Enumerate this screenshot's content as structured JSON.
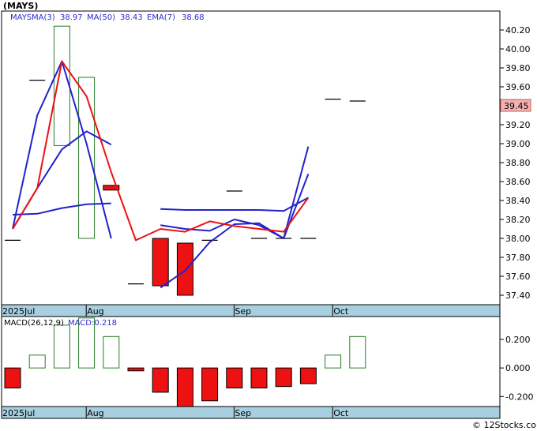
{
  "title": "(MAYS)",
  "watermark": "© 12Stocks.com",
  "last_price_label": "39.45",
  "colors": {
    "up": "#2a7a2a",
    "down": "#ee1111",
    "blue_line": "#2222cc",
    "red_line": "#ee1111",
    "date_band": "#a8cfe0",
    "price_tag_bg": "#f5b0b0",
    "grid": "#cccccc"
  },
  "legend": {
    "ticker": "MAYS",
    "ma3": "MA(3)",
    "ma3_value": "38.97",
    "ma50": "MA(50)",
    "ma50_value": "38.43",
    "ema7": "EMA(7)",
    "ema7_value": "38.68"
  },
  "macd_legend": {
    "label": "MACD(26,12,9)",
    "value_label": "MACD:0.218"
  },
  "chart_data": [
    {
      "type": "candlestick",
      "panel": "price",
      "dates": [
        "2025Jul",
        "Aug",
        "Sep",
        "Oct"
      ],
      "date_positions_bar": [
        0,
        3.5,
        9.5,
        13.5
      ],
      "ylim": [
        37.3,
        40.4
      ],
      "yticks": [
        "37.40",
        "37.60",
        "37.80",
        "38.00",
        "38.20",
        "38.40",
        "38.60",
        "38.80",
        "39.00",
        "39.20",
        "39.40",
        "39.60",
        "39.80",
        "40.00",
        "40.20"
      ],
      "bars": [
        {
          "open": 37.98,
          "close": 37.98
        },
        {
          "open": 39.67,
          "close": 39.67
        },
        {
          "open": 38.98,
          "close": 40.24
        },
        {
          "open": 38.0,
          "close": 39.7
        },
        {
          "open": 38.56,
          "close": 38.51
        },
        {
          "open": 37.52,
          "close": 37.52
        },
        {
          "open": 38.0,
          "close": 37.5
        },
        {
          "open": 37.95,
          "close": 37.4
        },
        {
          "open": 37.98,
          "close": 37.98
        },
        {
          "open": 38.5,
          "close": 38.5
        },
        {
          "open": 38.0,
          "close": 38.0
        },
        {
          "open": 38.0,
          "close": 38.0
        },
        {
          "open": 38.0,
          "close": 38.0
        },
        {
          "open": 39.47,
          "close": 39.47
        },
        {
          "open": 39.45,
          "close": 39.45
        }
      ],
      "series": [
        {
          "name": "MA(3)",
          "color": "#2222cc",
          "values": [
            38.1,
            39.3,
            39.87,
            39.0,
            38.0,
            null,
            37.48,
            37.66,
            37.96,
            38.15,
            38.16,
            38.0,
            38.97
          ]
        },
        {
          "name": "EMA(7)",
          "color": "#2222cc",
          "values": [
            38.1,
            38.53,
            38.94,
            39.13,
            38.99,
            null,
            38.14,
            38.1,
            38.08,
            38.2,
            38.14,
            38.0,
            38.68
          ]
        },
        {
          "name": "MA(50)",
          "color": "#2222cc",
          "values": [
            38.25,
            38.26,
            38.32,
            38.36,
            38.37,
            null,
            38.31,
            38.3,
            38.3,
            38.3,
            38.3,
            38.29,
            38.43
          ]
        },
        {
          "name": "Red line",
          "color": "#ee1111",
          "values": [
            38.1,
            38.53,
            39.87,
            39.5,
            38.7,
            37.98,
            38.1,
            38.07,
            38.18,
            38.13,
            38.1,
            38.07,
            38.43
          ]
        }
      ]
    },
    {
      "type": "bar",
      "panel": "macd",
      "ylim": [
        -0.27,
        0.36
      ],
      "yticks": [
        "-0.200",
        "0.000",
        "0.200"
      ],
      "values": [
        -0.14,
        0.09,
        0.3,
        0.35,
        0.22,
        -0.02,
        -0.17,
        -0.27,
        -0.23,
        -0.14,
        -0.14,
        -0.13,
        -0.11,
        0.09,
        0.22
      ]
    }
  ]
}
